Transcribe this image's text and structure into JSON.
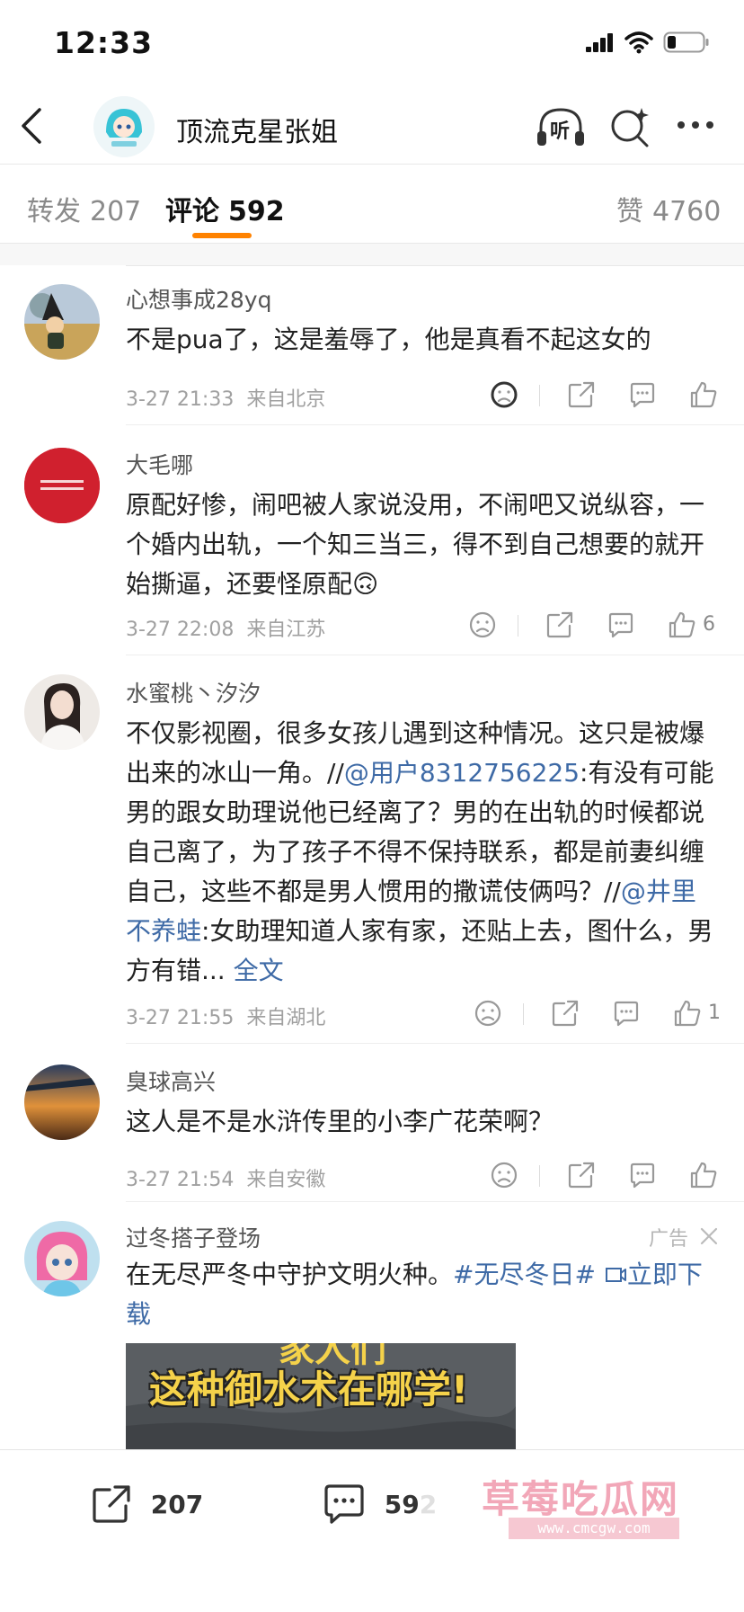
{
  "status_bar": {
    "time": "12:33"
  },
  "header": {
    "title": "顶流克星张姐",
    "listen_label": "听"
  },
  "tabs": {
    "reposts_label": "转发",
    "reposts_count": "207",
    "comments_label": "评论",
    "comments_count": "592",
    "likes_label": "赞",
    "likes_count": "4760"
  },
  "comments": [
    {
      "user": "心想事成28yq",
      "text": "不是pua了，这是羞辱了，他是真看不起这女的",
      "date": "3-27 21:33",
      "location": "来自北京",
      "likes": ""
    },
    {
      "user": "大毛哪",
      "text": "原配好惨，闹吧被人家说没用，不闹吧又说纵容，一个婚内出轨，一个知三当三，得不到自己想要的就开始撕逼，还要怪原配",
      "emoji": "🙃",
      "date": "3-27 22:08",
      "location": "来自江苏",
      "likes": "6"
    },
    {
      "user": "水蜜桃丶汐汐",
      "text_a": "不仅影视圈，很多女孩儿遇到这种情况。这只是被爆出来的冰山一角。//",
      "mention_1": "@用户8312756225",
      "text_b": ":有没有可能男的跟女助理说他已经离了？男的在出轨的时候都说自己离了，为了孩子不得不保持联系，都是前妻纠缠自己，这些不都是男人惯用的撒谎伎俩吗？//",
      "mention_2": "@井里不养蛙",
      "text_c": ":女助理知道人家有家，还贴上去，图什么，男方有错...",
      "more": " 全文",
      "date": "3-27 21:55",
      "location": "来自湖北",
      "likes": "1"
    },
    {
      "user": "臭球高兴",
      "text": "这人是不是水浒传里的小李广花荣啊？",
      "date": "3-27 21:54",
      "location": "来自安徽",
      "likes": ""
    }
  ],
  "ad": {
    "user": "过冬搭子登场",
    "tag": "广告",
    "text": "在尽严冬中守护文明火种。",
    "text_full": "在无尽严冬中守护文明火种。",
    "topic": "#无尽冬日#",
    "link": "立即下载",
    "image_caption_top": "家人们",
    "image_caption": "这种御水术在哪学!"
  },
  "bottom_bar": {
    "reposts": "207",
    "comments": "592"
  },
  "watermark": {
    "text": "草莓吃瓜网",
    "url": "www.cmcgw.com"
  },
  "colors": {
    "accent": "#ff8200",
    "link": "#3e6aa6",
    "watermark": "#f2a7b8"
  }
}
